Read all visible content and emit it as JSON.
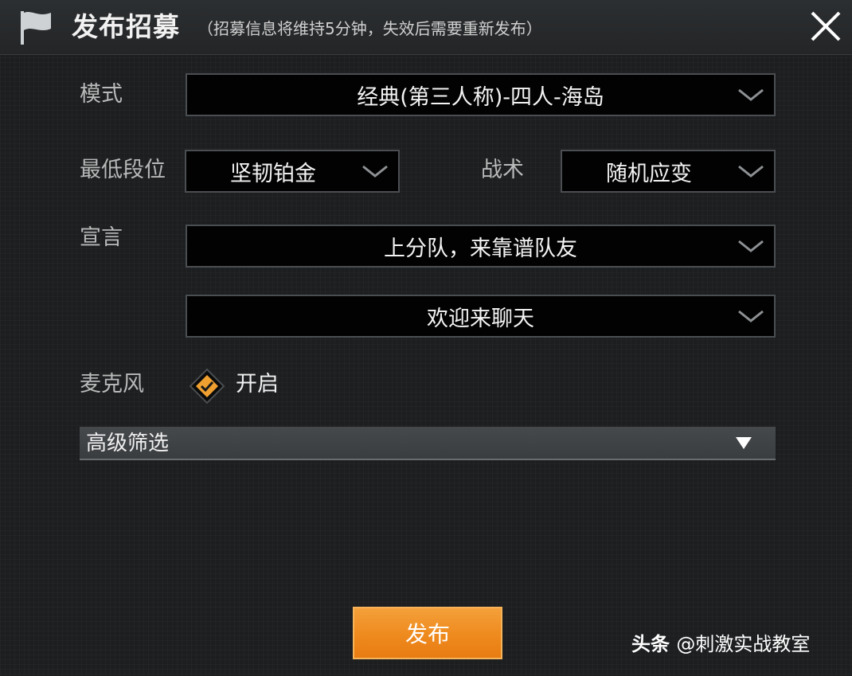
{
  "header": {
    "title": "发布招募",
    "subtitle": "（招募信息将维持5分钟，失效后需要重新发布）",
    "icons": {
      "flag": "flag-icon",
      "close": "close-icon"
    }
  },
  "form": {
    "mode": {
      "label": "模式",
      "value": "经典(第三人称)-四人-海岛"
    },
    "min_rank": {
      "label": "最低段位",
      "value": "坚韧铂金"
    },
    "tactic": {
      "label": "战术",
      "value": "随机应变"
    },
    "declaration": {
      "label": "宣言",
      "value_1": "上分队，来靠谱队友",
      "value_2": "欢迎来聊天"
    },
    "microphone": {
      "label": "麦克风",
      "option_label": "开启",
      "checked": true
    },
    "advanced_filter": {
      "label": "高级筛选"
    }
  },
  "publish_button": {
    "label": "发布"
  },
  "watermark": {
    "brand": "头条",
    "account": "@刺激实战教室"
  },
  "colors": {
    "accent": "#ee8a1e",
    "check": "#f0a030",
    "background": "#1c1e20"
  }
}
